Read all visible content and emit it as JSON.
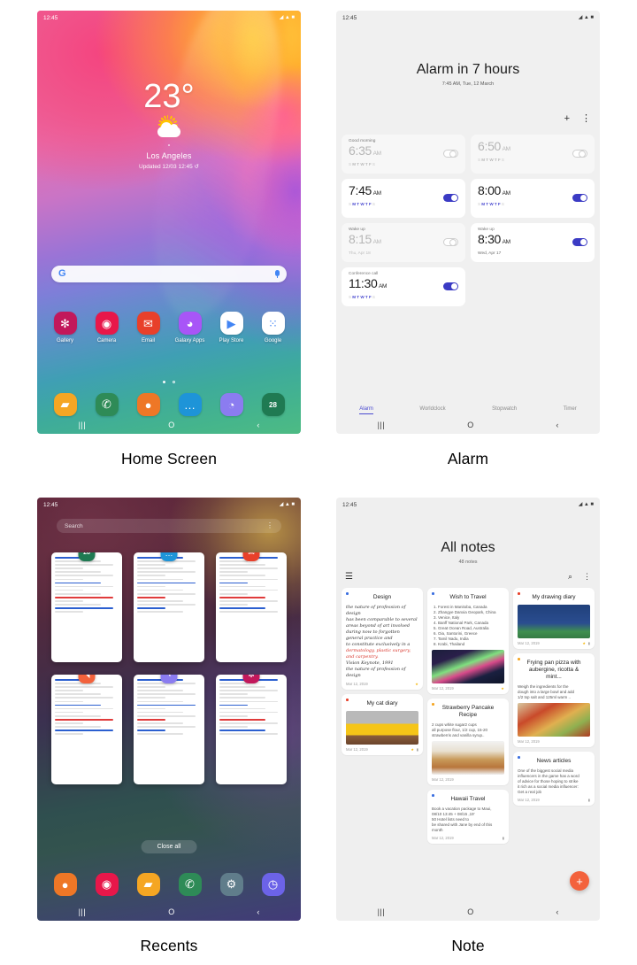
{
  "captions": {
    "home": "Home Screen",
    "alarm": "Alarm",
    "recents": "Recents",
    "note": "Note"
  },
  "status": {
    "time": "12:45",
    "wifi": "wifi-icon",
    "signal": "signal-icon",
    "battery": "battery-icon"
  },
  "nav": {
    "recents": "|||",
    "home": "O",
    "back": "‹"
  },
  "home": {
    "weather": {
      "temperature": "23°",
      "condition_icon": "partly-cloudy-icon",
      "location_pin": "⚬",
      "city": "Los Angeles",
      "updated": "Updated 12/03 12:45 ↺"
    },
    "search": {
      "logo": "G",
      "placeholder": "",
      "mic": "mic-icon"
    },
    "apps": [
      {
        "label": "Gallery",
        "glyph": "✻",
        "color": "#c2185b"
      },
      {
        "label": "Camera",
        "glyph": "◉",
        "color": "#e8174a"
      },
      {
        "label": "Email",
        "glyph": "✉",
        "color": "#e8402a"
      },
      {
        "label": "Galaxy Apps",
        "glyph": "◕",
        "color": "#a855f7"
      },
      {
        "label": "Play Store",
        "glyph": "▶",
        "color": "#ffffff"
      },
      {
        "label": "Google",
        "glyph": "⁙",
        "color": "#ffffff"
      }
    ],
    "page_dots": {
      "current": 1,
      "total": 2
    },
    "dock": [
      {
        "name": "my-files",
        "glyph": "▰",
        "color": "#f5a623"
      },
      {
        "name": "phone",
        "glyph": "✆",
        "color": "#2e8b57"
      },
      {
        "name": "contacts",
        "glyph": "●",
        "color": "#ee7726"
      },
      {
        "name": "messages",
        "glyph": "…",
        "color": "#1e94d8"
      },
      {
        "name": "internet",
        "glyph": "◔",
        "color": "#8b7cf0"
      },
      {
        "name": "calendar",
        "glyph": "28",
        "color": "#1f7a52"
      }
    ]
  },
  "alarm": {
    "heading": "Alarm in 7 hours",
    "subheading": "7:45 AM, Tue, 12 March",
    "add_label": "+",
    "more_label": "⋮",
    "day_letters": [
      "S",
      "M",
      "T",
      "W",
      "T",
      "F",
      "S"
    ],
    "cards": [
      {
        "label": "Good morning",
        "time": "6:35",
        "ampm": "AM",
        "enabled": false,
        "days": true,
        "date": ""
      },
      {
        "label": "",
        "time": "6:50",
        "ampm": "AM",
        "enabled": false,
        "days": true,
        "date": ""
      },
      {
        "label": "",
        "time": "7:45",
        "ampm": "AM",
        "enabled": true,
        "days": true,
        "date": ""
      },
      {
        "label": "",
        "time": "8:00",
        "ampm": "AM",
        "enabled": true,
        "days": true,
        "date": ""
      },
      {
        "label": "Wake up",
        "time": "8:15",
        "ampm": "AM",
        "enabled": false,
        "days": false,
        "date": "Thu, Apr 18"
      },
      {
        "label": "Wake up",
        "time": "8:30",
        "ampm": "AM",
        "enabled": true,
        "days": false,
        "date": "Wed, Apr 17"
      },
      {
        "label": "Conference call",
        "time": "11:30",
        "ampm": "AM",
        "enabled": true,
        "days": true,
        "date": ""
      }
    ],
    "tabs": [
      {
        "label": "Alarm",
        "active": true
      },
      {
        "label": "Worldclock",
        "active": false
      },
      {
        "label": "Stopwatch",
        "active": false
      },
      {
        "label": "Timer",
        "active": false
      }
    ],
    "accent": "#4a4ad0"
  },
  "recents": {
    "search_placeholder": "Search",
    "more_label": "⋮",
    "close_all": "Close all",
    "cards": [
      {
        "app": "calendar",
        "glyph": "28",
        "color": "#1f7a52"
      },
      {
        "app": "messages",
        "glyph": "…",
        "color": "#1e94d8"
      },
      {
        "app": "email",
        "glyph": "✉",
        "color": "#e8402a"
      },
      {
        "app": "notes",
        "glyph": "◥",
        "color": "#f3623c"
      },
      {
        "app": "internet",
        "glyph": "◔",
        "color": "#8b7cf0"
      },
      {
        "app": "gallery",
        "glyph": "✻",
        "color": "#c2185b"
      }
    ],
    "dock": [
      {
        "name": "contacts",
        "glyph": "●",
        "color": "#ee7726"
      },
      {
        "name": "camera",
        "glyph": "◉",
        "color": "#e8174a"
      },
      {
        "name": "my-files",
        "glyph": "▰",
        "color": "#f5a623"
      },
      {
        "name": "phone",
        "glyph": "✆",
        "color": "#2e8b57"
      },
      {
        "name": "settings",
        "glyph": "⚙",
        "color": "#607d8b"
      },
      {
        "name": "clock",
        "glyph": "◷",
        "color": "#6c63e8"
      }
    ]
  },
  "note": {
    "heading": "All notes",
    "subheading": "48 notes",
    "menu_label": "☰",
    "search_label": "⌕",
    "more_label": "⋮",
    "fab_label": "+",
    "cards": [
      {
        "title": "Design",
        "dot": "#3b6fe0",
        "kind": "handwriting",
        "lines": [
          "the nature of profession of design",
          "has been comparable to several",
          "areas beyond of art involved",
          "during now to forgotten",
          "general practice and",
          "to constitute exclusively in a",
          "dermatology, plastic surgery,",
          "and carpentry.",
          "Vision Keynote, 1991",
          "the nature of profession of design"
        ],
        "date": "Mar 12, 2019",
        "marks": [
          "star"
        ]
      },
      {
        "title": "My cat diary",
        "dot": "#e8402a",
        "kind": "image",
        "image": "cat",
        "date": "Mar 12, 2019",
        "marks": [
          "star",
          "lock"
        ]
      },
      {
        "title": "Wish to Travel",
        "dot": "#3b6fe0",
        "kind": "list-image",
        "image": "aurora",
        "lines": [
          "1. Forest in Manitoba, Canada",
          "2. Zhangye Danxia Geopark, China",
          "3. Venice, Italy",
          "4. Banff National Park, Canada",
          "5. Great Ocean Road, Australia",
          "6. Oia, Santorini, Greece",
          "7. Tamil Nadu, India",
          "8. Krabi, Thailand"
        ],
        "date": "Mar 12, 2019",
        "marks": [
          "star"
        ]
      },
      {
        "title": "Strawberry Pancake Recipe",
        "dot": "#f5a623",
        "kind": "text-image",
        "image": "pancake",
        "lines": [
          "2 cups white sugar2 cups",
          "all purpose flour, 1/2 cup, 15-20",
          "strawberris and vanilla syrup.."
        ],
        "date": "Mar 12, 2019",
        "marks": []
      },
      {
        "title": "Hawaii Travel",
        "dot": "#3b6fe0",
        "kind": "text",
        "lines": [
          "Book a vacation package to Maui,",
          "08/10 13:45 + 08/15 ,19'",
          "50 Hotel lists need to",
          "be shared with Jane by end of this",
          "month"
        ],
        "date": "Mar 12, 2019",
        "marks": [
          "lock"
        ]
      },
      {
        "title": "My drawing diary",
        "dot": "#e8402a",
        "kind": "image",
        "image": "drawing",
        "date": "Mar 12, 2019",
        "marks": [
          "star",
          "lock"
        ]
      },
      {
        "title": "Frying pan pizza with aubergine, ricotta & mint...",
        "dot": "#f5a623",
        "kind": "text-image",
        "image": "pizza",
        "lines": [
          "Weigh the ingredients for the",
          "dough into a large bowl and add",
          "1/2 tsp salt and 125ml warm .."
        ],
        "date": "Mar 12, 2019",
        "marks": []
      },
      {
        "title": "News articles",
        "dot": "#3b6fe0",
        "kind": "text",
        "lines": [
          "One of the biggest social media",
          "influencers in the game has a word",
          "of advice for those hoping to strike",
          "it rich as a social media influencer:",
          "Get a real job"
        ],
        "date": "Mar 12, 2019",
        "marks": [
          "lock"
        ]
      }
    ]
  }
}
